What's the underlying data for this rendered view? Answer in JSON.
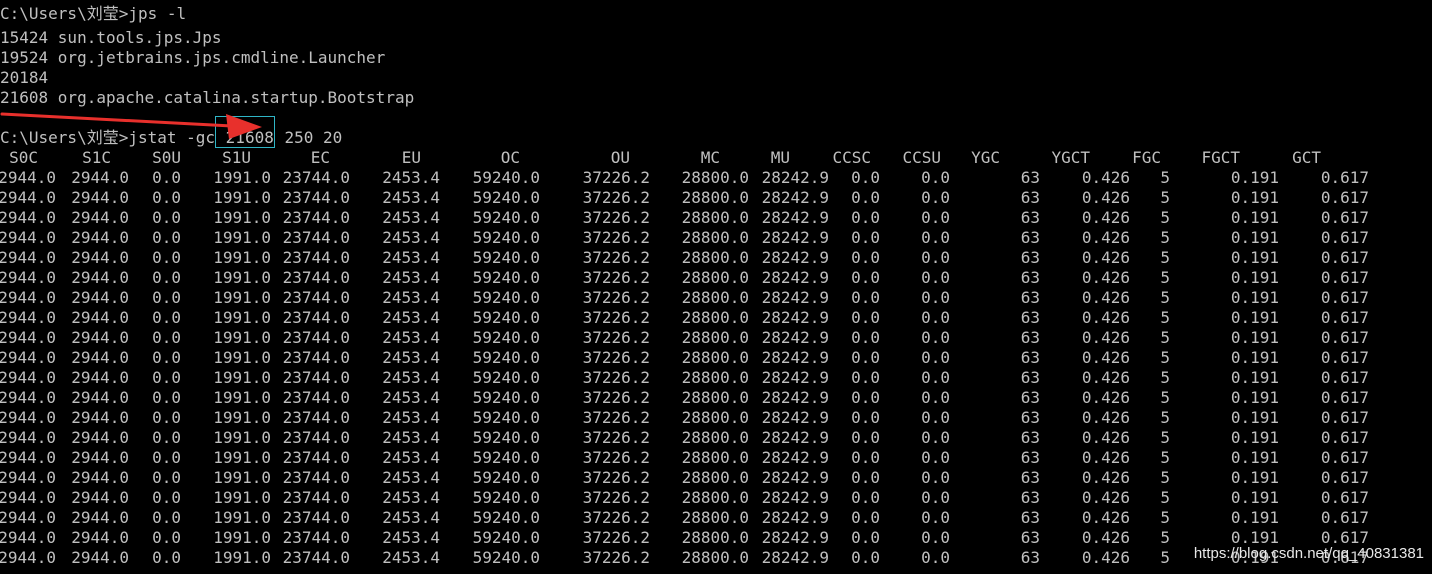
{
  "terminal": {
    "colors": {
      "background": "#000000",
      "text": "#c0c0c0",
      "highlight_box": "#2fb5c6",
      "arrow": "#e8302c"
    },
    "lines": [
      "C:\\Users\\刘莹>jps -l",
      "15424 sun.tools.jps.Jps",
      "19524 org.jetbrains.jps.cmdline.Launcher",
      "20184",
      "21608 org.apache.catalina.startup.Bootstrap",
      ""
    ],
    "command": {
      "prompt_before": "C:\\Users\\刘莹>jstat -gc",
      "pid": "21608",
      "args": "250 20"
    },
    "table": {
      "headers": [
        "S0C",
        "S1C",
        "S0U",
        "S1U",
        "EC",
        "EU",
        "OC",
        "OU",
        "MC",
        "MU",
        "CCSC",
        "CCSU",
        "YGC",
        "YGCT",
        "FGC",
        "FGCT",
        "GCT"
      ],
      "rows": [
        [
          "2944.0",
          "2944.0",
          "0.0",
          "1991.0",
          "23744.0",
          "2453.4",
          "59240.0",
          "37226.2",
          "28800.0",
          "28242.9",
          "0.0",
          "0.0",
          "63",
          "0.426",
          "5",
          "0.191",
          "0.617"
        ],
        [
          "2944.0",
          "2944.0",
          "0.0",
          "1991.0",
          "23744.0",
          "2453.4",
          "59240.0",
          "37226.2",
          "28800.0",
          "28242.9",
          "0.0",
          "0.0",
          "63",
          "0.426",
          "5",
          "0.191",
          "0.617"
        ],
        [
          "2944.0",
          "2944.0",
          "0.0",
          "1991.0",
          "23744.0",
          "2453.4",
          "59240.0",
          "37226.2",
          "28800.0",
          "28242.9",
          "0.0",
          "0.0",
          "63",
          "0.426",
          "5",
          "0.191",
          "0.617"
        ],
        [
          "2944.0",
          "2944.0",
          "0.0",
          "1991.0",
          "23744.0",
          "2453.4",
          "59240.0",
          "37226.2",
          "28800.0",
          "28242.9",
          "0.0",
          "0.0",
          "63",
          "0.426",
          "5",
          "0.191",
          "0.617"
        ],
        [
          "2944.0",
          "2944.0",
          "0.0",
          "1991.0",
          "23744.0",
          "2453.4",
          "59240.0",
          "37226.2",
          "28800.0",
          "28242.9",
          "0.0",
          "0.0",
          "63",
          "0.426",
          "5",
          "0.191",
          "0.617"
        ],
        [
          "2944.0",
          "2944.0",
          "0.0",
          "1991.0",
          "23744.0",
          "2453.4",
          "59240.0",
          "37226.2",
          "28800.0",
          "28242.9",
          "0.0",
          "0.0",
          "63",
          "0.426",
          "5",
          "0.191",
          "0.617"
        ],
        [
          "2944.0",
          "2944.0",
          "0.0",
          "1991.0",
          "23744.0",
          "2453.4",
          "59240.0",
          "37226.2",
          "28800.0",
          "28242.9",
          "0.0",
          "0.0",
          "63",
          "0.426",
          "5",
          "0.191",
          "0.617"
        ],
        [
          "2944.0",
          "2944.0",
          "0.0",
          "1991.0",
          "23744.0",
          "2453.4",
          "59240.0",
          "37226.2",
          "28800.0",
          "28242.9",
          "0.0",
          "0.0",
          "63",
          "0.426",
          "5",
          "0.191",
          "0.617"
        ],
        [
          "2944.0",
          "2944.0",
          "0.0",
          "1991.0",
          "23744.0",
          "2453.4",
          "59240.0",
          "37226.2",
          "28800.0",
          "28242.9",
          "0.0",
          "0.0",
          "63",
          "0.426",
          "5",
          "0.191",
          "0.617"
        ],
        [
          "2944.0",
          "2944.0",
          "0.0",
          "1991.0",
          "23744.0",
          "2453.4",
          "59240.0",
          "37226.2",
          "28800.0",
          "28242.9",
          "0.0",
          "0.0",
          "63",
          "0.426",
          "5",
          "0.191",
          "0.617"
        ],
        [
          "2944.0",
          "2944.0",
          "0.0",
          "1991.0",
          "23744.0",
          "2453.4",
          "59240.0",
          "37226.2",
          "28800.0",
          "28242.9",
          "0.0",
          "0.0",
          "63",
          "0.426",
          "5",
          "0.191",
          "0.617"
        ],
        [
          "2944.0",
          "2944.0",
          "0.0",
          "1991.0",
          "23744.0",
          "2453.4",
          "59240.0",
          "37226.2",
          "28800.0",
          "28242.9",
          "0.0",
          "0.0",
          "63",
          "0.426",
          "5",
          "0.191",
          "0.617"
        ],
        [
          "2944.0",
          "2944.0",
          "0.0",
          "1991.0",
          "23744.0",
          "2453.4",
          "59240.0",
          "37226.2",
          "28800.0",
          "28242.9",
          "0.0",
          "0.0",
          "63",
          "0.426",
          "5",
          "0.191",
          "0.617"
        ],
        [
          "2944.0",
          "2944.0",
          "0.0",
          "1991.0",
          "23744.0",
          "2453.4",
          "59240.0",
          "37226.2",
          "28800.0",
          "28242.9",
          "0.0",
          "0.0",
          "63",
          "0.426",
          "5",
          "0.191",
          "0.617"
        ],
        [
          "2944.0",
          "2944.0",
          "0.0",
          "1991.0",
          "23744.0",
          "2453.4",
          "59240.0",
          "37226.2",
          "28800.0",
          "28242.9",
          "0.0",
          "0.0",
          "63",
          "0.426",
          "5",
          "0.191",
          "0.617"
        ],
        [
          "2944.0",
          "2944.0",
          "0.0",
          "1991.0",
          "23744.0",
          "2453.4",
          "59240.0",
          "37226.2",
          "28800.0",
          "28242.9",
          "0.0",
          "0.0",
          "63",
          "0.426",
          "5",
          "0.191",
          "0.617"
        ],
        [
          "2944.0",
          "2944.0",
          "0.0",
          "1991.0",
          "23744.0",
          "2453.4",
          "59240.0",
          "37226.2",
          "28800.0",
          "28242.9",
          "0.0",
          "0.0",
          "63",
          "0.426",
          "5",
          "0.191",
          "0.617"
        ],
        [
          "2944.0",
          "2944.0",
          "0.0",
          "1991.0",
          "23744.0",
          "2453.4",
          "59240.0",
          "37226.2",
          "28800.0",
          "28242.9",
          "0.0",
          "0.0",
          "63",
          "0.426",
          "5",
          "0.191",
          "0.617"
        ],
        [
          "2944.0",
          "2944.0",
          "0.0",
          "1991.0",
          "23744.0",
          "2453.4",
          "59240.0",
          "37226.2",
          "28800.0",
          "28242.9",
          "0.0",
          "0.0",
          "63",
          "0.426",
          "5",
          "0.191",
          "0.617"
        ],
        [
          "2944.0",
          "2944.0",
          "0.0",
          "1991.0",
          "23744.0",
          "2453.4",
          "59240.0",
          "37226.2",
          "28800.0",
          "28242.9",
          "0.0",
          "0.0",
          "63",
          "0.426",
          "5",
          "0.191",
          "0.617"
        ]
      ]
    }
  },
  "annotation": {
    "arrow_icon": "red-arrow-icon"
  },
  "watermark": "https://blog.csdn.net/qq_40831381"
}
